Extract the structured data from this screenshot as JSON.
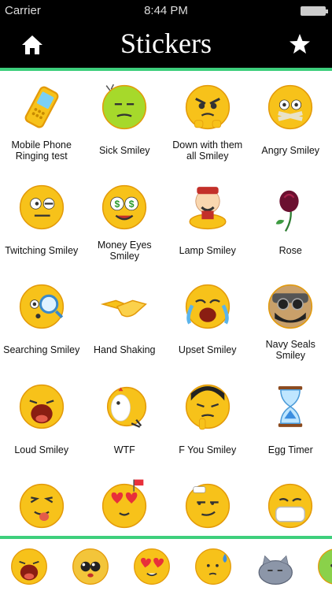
{
  "status": {
    "carrier": "Carrier",
    "time": "8:44 PM"
  },
  "header": {
    "title": "Stickers",
    "left_icon": "home-icon",
    "right_icon": "star-icon"
  },
  "accent_color": "#3ecf7c",
  "stickers": [
    {
      "label": "Mobile Phone Ringing test",
      "icon": "phone"
    },
    {
      "label": "Sick Smiley",
      "icon": "sick"
    },
    {
      "label": "Down with them all Smiley",
      "icon": "down"
    },
    {
      "label": "Angry Smiley",
      "icon": "angry"
    },
    {
      "label": "Twitching Smiley",
      "icon": "twitch"
    },
    {
      "label": "Money Eyes Smiley",
      "icon": "money"
    },
    {
      "label": "Lamp Smiley",
      "icon": "lamp"
    },
    {
      "label": "Rose",
      "icon": "rose"
    },
    {
      "label": "Searching Smiley",
      "icon": "search"
    },
    {
      "label": "Hand Shaking",
      "icon": "hands"
    },
    {
      "label": "Upset Smiley",
      "icon": "upset"
    },
    {
      "label": "Navy Seals Smiley",
      "icon": "navy"
    },
    {
      "label": "Loud Smiley",
      "icon": "loud"
    },
    {
      "label": "WTF",
      "icon": "wtf"
    },
    {
      "label": "F You Smiley",
      "icon": "fyou"
    },
    {
      "label": "Egg Timer",
      "icon": "hourglass"
    },
    {
      "label": "",
      "icon": "tongue"
    },
    {
      "label": "",
      "icon": "love"
    },
    {
      "label": "",
      "icon": "smug"
    },
    {
      "label": "",
      "icon": "mask"
    }
  ],
  "bottom_bar": [
    {
      "icon": "loud"
    },
    {
      "icon": "puppy"
    },
    {
      "icon": "heart-eyes"
    },
    {
      "icon": "sweat"
    },
    {
      "icon": "cat"
    },
    {
      "icon": "green"
    }
  ]
}
